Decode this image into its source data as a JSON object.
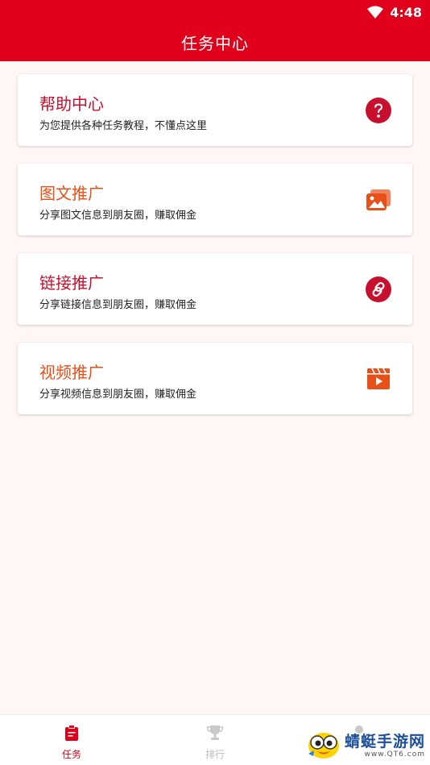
{
  "status_bar": {
    "time": "4:48"
  },
  "header": {
    "title": "任务中心"
  },
  "cards": [
    {
      "title": "帮助中心",
      "subtitle": "为您提供各种任务教程，不懂点这里",
      "icon": "question-icon",
      "color": "#c8102e"
    },
    {
      "title": "图文推广",
      "subtitle": "分享图文信息到朋友圈，赚取佣金",
      "icon": "image-icon",
      "color": "#e8501a"
    },
    {
      "title": "链接推广",
      "subtitle": "分享链接信息到朋友圈，赚取佣金",
      "icon": "link-icon",
      "color": "#c8102e"
    },
    {
      "title": "视频推广",
      "subtitle": "分享视频信息到朋友圈，赚取佣金",
      "icon": "video-icon",
      "color": "#e8501a"
    }
  ],
  "bottom_nav": [
    {
      "label": "任务",
      "icon": "clipboard-icon",
      "active": true
    },
    {
      "label": "排行",
      "icon": "trophy-icon",
      "active": false
    }
  ],
  "watermark": {
    "main": "蜻蜓手游网",
    "sub": "www.QT6.com"
  },
  "colors": {
    "primary": "#e0001b",
    "accent_orange": "#e8501a",
    "inactive": "#bbbbbb"
  }
}
